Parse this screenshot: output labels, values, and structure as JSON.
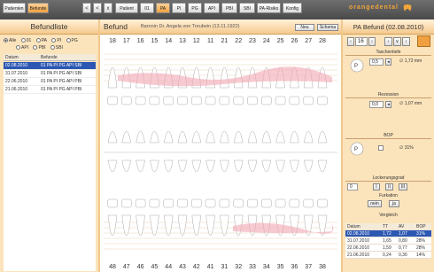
{
  "topbar": {
    "tabs": [
      "Patienten",
      "Befunde"
    ],
    "active_tab": "Befunde",
    "nav": [
      "<",
      "<",
      "x"
    ],
    "buttons": [
      "Patient",
      "01",
      "PA",
      "PI",
      "PG",
      "API",
      "PBI",
      "SBI",
      "PA-Risiko",
      "Konfig"
    ],
    "active_button": "PA",
    "brand": "orangedental"
  },
  "left": {
    "title": "Befundliste",
    "filters": [
      "Alle",
      "01",
      "PA",
      "PI",
      "PG",
      "API",
      "PBI",
      "SBI"
    ],
    "selected_filter": "Alle",
    "columns": [
      "Datum",
      "Befunde"
    ],
    "rows": [
      {
        "date": "02.08.2010",
        "findings": "01 PA PI PG API SBI"
      },
      {
        "date": "31.07.2010",
        "findings": "01 PA PI PG API SBI"
      },
      {
        "date": "22.06.2010",
        "findings": "01 PA PI PG API PBI"
      },
      {
        "date": "21.06.2010",
        "findings": "01 PA PI PG API PBI"
      }
    ]
  },
  "mid": {
    "title": "Befund",
    "patient": "Baronin Dr. Angela von Treubein (13.11.1922)",
    "new_button": "Neu",
    "scheme_button": "Schema",
    "upper_teeth": [
      "18",
      "17",
      "16",
      "15",
      "14",
      "13",
      "12",
      "11",
      "21",
      "22",
      "23",
      "24",
      "25",
      "26",
      "27",
      "28"
    ],
    "lower_teeth": [
      "48",
      "47",
      "46",
      "45",
      "44",
      "43",
      "42",
      "41",
      "31",
      "32",
      "33",
      "34",
      "35",
      "36",
      "37",
      "38"
    ]
  },
  "right": {
    "title": "PA Befund (02.08.2010)",
    "tooth": "16",
    "sections": {
      "touchierte": "Taschentiefe",
      "rezession": "Rezession",
      "bop": "BOP",
      "lockerung": "Lockerungsgrad",
      "furkation": "Furkation",
      "vergleich": "Vergleich"
    },
    "pocket_value": "0,5",
    "pocket_avg": "1,72 mm",
    "recession_value": "0,0",
    "recession_avg": "1,07 mm",
    "bop_pct": "31%",
    "mobility_value": "0",
    "mobility_options": [
      "I",
      "II",
      "III"
    ],
    "furcation_options": [
      "nein",
      "ja"
    ],
    "compare": {
      "columns": [
        "Datum",
        "TT",
        "AV",
        "BOP"
      ],
      "rows": [
        {
          "date": "02.08.2010",
          "tt": "1,72",
          "av": "1,07",
          "bop": "31%"
        },
        {
          "date": "31.07.2010",
          "tt": "1,65",
          "av": "0,80",
          "bop": "28%"
        },
        {
          "date": "22.06.2010",
          "tt": "1,59",
          "av": "0,77",
          "bop": "28%"
        },
        {
          "date": "21.06.2010",
          "tt": "0,24",
          "av": "0,36",
          "bop": "14%"
        }
      ]
    }
  }
}
